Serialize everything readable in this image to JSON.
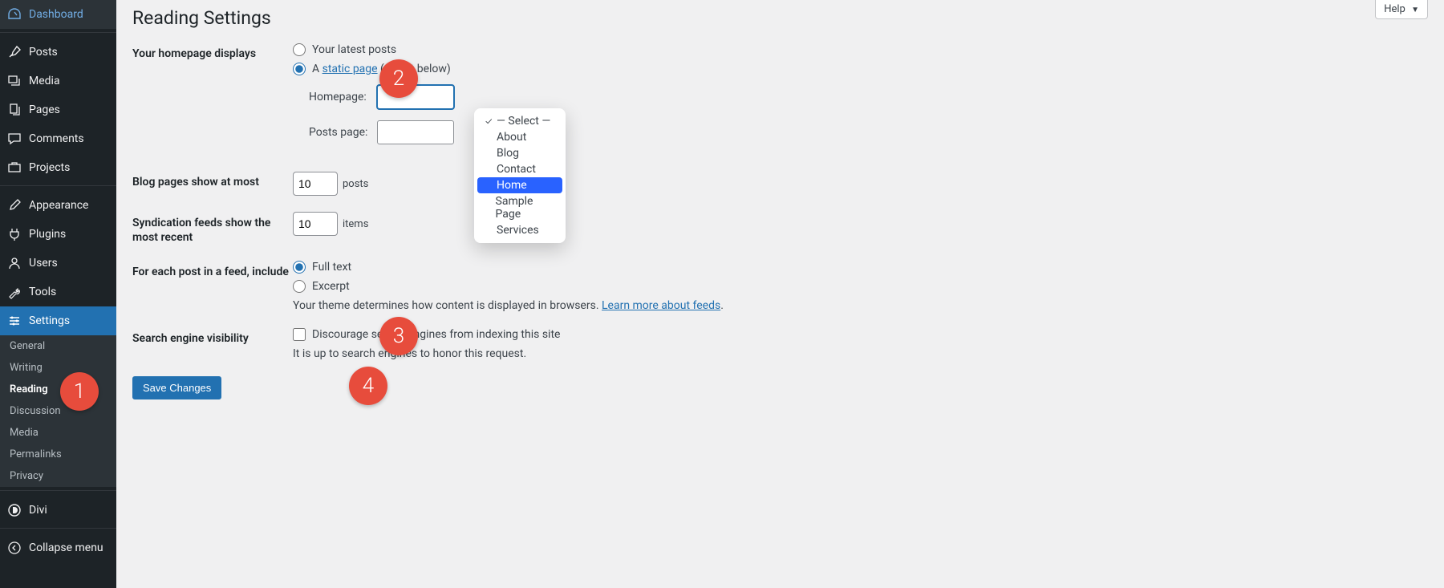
{
  "sidebar": {
    "items": [
      {
        "label": "Dashboard"
      },
      {
        "label": "Posts"
      },
      {
        "label": "Media"
      },
      {
        "label": "Pages"
      },
      {
        "label": "Comments"
      },
      {
        "label": "Projects"
      },
      {
        "label": "Appearance"
      },
      {
        "label": "Plugins"
      },
      {
        "label": "Users"
      },
      {
        "label": "Tools"
      },
      {
        "label": "Settings"
      },
      {
        "label": "Divi"
      },
      {
        "label": "Collapse menu"
      }
    ],
    "settings_submenu": [
      "General",
      "Writing",
      "Reading",
      "Discussion",
      "Media",
      "Permalinks",
      "Privacy"
    ]
  },
  "header": {
    "title": "Reading Settings",
    "help": "Help"
  },
  "form": {
    "homepage_displays_label": "Your homepage displays",
    "radio_latest": "Your latest posts",
    "radio_static_prefix": "A ",
    "radio_static_link": "static page",
    "radio_static_suffix": " (select below)",
    "homepage_select_label": "Homepage:",
    "posts_page_label": "Posts page:",
    "homepage_options": [
      "— Select —",
      "About",
      "Blog",
      "Contact",
      "Home",
      "Sample Page",
      "Services"
    ],
    "homepage_highlighted": "Home",
    "blog_pages_label": "Blog pages show at most",
    "blog_pages_value": "10",
    "blog_pages_unit": "posts",
    "syndication_label": "Syndication feeds show the most recent",
    "syndication_value": "10",
    "syndication_unit": "items",
    "feed_label": "For each post in a feed, include",
    "feed_full": "Full text",
    "feed_excerpt": "Excerpt",
    "feed_desc_pre": "Your theme determines how content is displayed in browsers. ",
    "feed_desc_link": "Learn more about feeds",
    "feed_desc_post": ".",
    "search_label": "Search engine visibility",
    "search_checkbox": "Discourage search engines from indexing this site",
    "search_desc": "It is up to search engines to honor this request.",
    "save_label": "Save Changes"
  },
  "badges": {
    "1": "1",
    "2": "2",
    "3": "3",
    "4": "4"
  }
}
